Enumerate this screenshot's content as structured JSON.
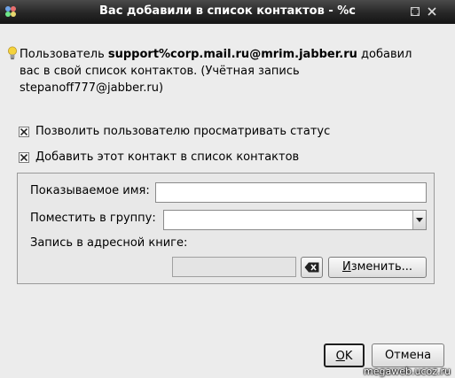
{
  "window": {
    "title": "Вас добавили в список контактов - %c"
  },
  "message": {
    "prefix": "Пользователь ",
    "jid": "support%corp.mail.ru@mrim.jabber.ru",
    "line1_rest": " добавил",
    "line2": "вас в свой список контактов. (Учётная запись",
    "line3": "stepanoff777@jabber.ru)"
  },
  "checkboxes": [
    {
      "label": "Позволить пользователю просматривать статус",
      "checked": true
    },
    {
      "label": "Добавить этот контакт в список контактов",
      "checked": true
    }
  ],
  "form": {
    "display_name_label": "Показываемое имя:",
    "display_name_value": "",
    "group_label": "Поместить в группу:",
    "group_value": "",
    "addressbook_label": "Запись в адресной книге:",
    "addressbook_value": "",
    "change_button": "Изменить...",
    "change_button_key": "И",
    "change_button_rest": "зменить..."
  },
  "buttons": {
    "ok_key": "О",
    "ok_rest": "K",
    "cancel_label": "Отмена"
  },
  "watermark": "megaweb.ucoz.ru",
  "colors": {
    "titlebar": "#262626",
    "window_bg": "#ececec",
    "bulb": "#f5d33b"
  }
}
